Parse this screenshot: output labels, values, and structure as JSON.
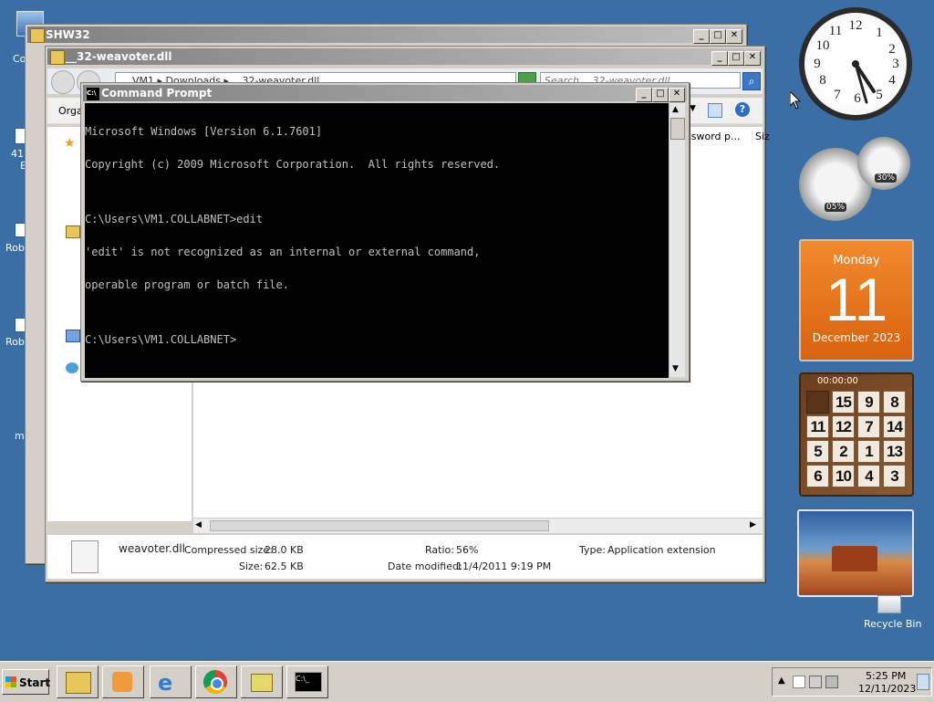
{
  "desktop": {
    "icons": [
      {
        "label": "Co",
        "name": "computer"
      },
      {
        "label": "41",
        "name": "shortcut-41"
      },
      {
        "label": "E",
        "name": "shortcut-e"
      },
      {
        "label": "Robl",
        "name": "robl-1"
      },
      {
        "label": "Robl",
        "name": "robl-2"
      },
      {
        "label": "ms",
        "name": "ms"
      }
    ],
    "recycle_bin_label": "Recycle Bin"
  },
  "shw32_window": {
    "title": "SHW32"
  },
  "explorer_window": {
    "title": "__32-weavoter.dll",
    "address": "VM1 ▸ Downloads ▸ __32-weavoter.dll",
    "search_placeholder": "Search __32-weavoter.dll",
    "organize_label": "Orga",
    "column_password": "ssword p...",
    "column_size": "Siz",
    "details": {
      "filename": "weavoter.dll",
      "compressed_size_label": "Compressed size:",
      "compressed_size_value": "28.0 KB",
      "size_label": "Size:",
      "size_value": "62.5 KB",
      "ratio_label": "Ratio:",
      "ratio_value": "56%",
      "date_label": "Date modified:",
      "date_value": "11/4/2011 9:19 PM",
      "type_label": "Type:",
      "type_value": "Application extension"
    }
  },
  "cmd_window": {
    "title": "Command Prompt",
    "lines": [
      "Microsoft Windows [Version 6.1.7601]",
      "Copyright (c) 2009 Microsoft Corporation.  All rights reserved.",
      "",
      "C:\\Users\\VM1.COLLABNET>edit",
      "'edit' is not recognized as an internal or external command,",
      "operable program or batch file.",
      "",
      "C:\\Users\\VM1.COLLABNET>"
    ]
  },
  "gadgets": {
    "clock_numbers": [
      "12",
      "1",
      "2",
      "3",
      "4",
      "5",
      "6",
      "7",
      "8",
      "9",
      "10",
      "11"
    ],
    "cpu_percent": "05%",
    "memory_percent": "30%",
    "calendar": {
      "weekday": "Monday",
      "day": "11",
      "month_year": "December 2023"
    },
    "puzzle": {
      "timer": "00:00:00",
      "tiles": [
        "",
        "15",
        "9",
        "8",
        "11",
        "12",
        "7",
        "14",
        "5",
        "2",
        "1",
        "13",
        "6",
        "10",
        "4",
        "3"
      ]
    }
  },
  "taskbar": {
    "start_label": "Start",
    "clock_time": "5:25 PM",
    "clock_date": "12/11/2023"
  }
}
